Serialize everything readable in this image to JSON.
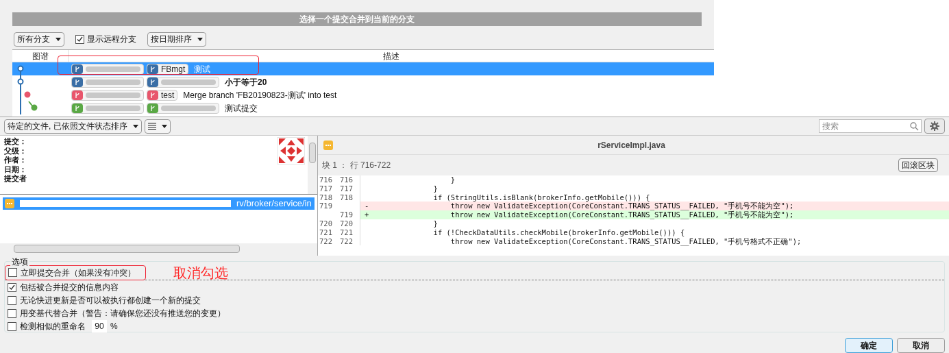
{
  "dialog": {
    "title": "选择一个提交合并到当前的分支",
    "toolbar": {
      "branch_filter": "所有分支",
      "show_remote": {
        "label": "显示远程分支",
        "checked": true
      },
      "sort": "按日期排序"
    },
    "columns": [
      "图谱",
      "描述"
    ],
    "commits": [
      {
        "selected": true,
        "refs": [
          {
            "color": "#3a6ea5"
          },
          {
            "label": "FBmgt",
            "color": "#3a6ea5"
          }
        ],
        "description": "测试",
        "bold": false,
        "color": "#2d6fb0"
      },
      {
        "selected": false,
        "refs": [
          {
            "color": "#3a6ea5"
          },
          {
            "color": "#3a6ea5"
          }
        ],
        "description": "小于等于20",
        "bold": true,
        "color": "#2d6fb0"
      },
      {
        "selected": false,
        "refs": [
          {
            "color": "#e8566c"
          },
          {
            "label": "test",
            "color": "#e8566c"
          }
        ],
        "description": "Merge branch 'FB20190823-测试' into test",
        "bold": false,
        "color": "#e8566c"
      },
      {
        "selected": false,
        "refs": [
          {
            "color": "#5aa845"
          },
          {
            "color": "#5aa845"
          }
        ],
        "description": "测试提交",
        "bold": false,
        "color": "#5aa845"
      }
    ],
    "annotation": "取消勾选"
  },
  "files_toolbar": {
    "sort": "待定的文件, 已依照文件状态排序",
    "search": {
      "placeholder": "搜索"
    }
  },
  "commit_info": [
    "提交：",
    "父级：",
    "作者：",
    "日期：",
    "提交者"
  ],
  "files": [
    {
      "path": "rv/broker/service/in",
      "selected": true
    }
  ],
  "diff": {
    "filename": "rServiceImpl.java",
    "hunk": "块 1 ： 行 716-722",
    "revert": "回滚区块",
    "lines": [
      {
        "old": "716",
        "new": "716",
        "kind": "context",
        "code": "            }"
      },
      {
        "old": "717",
        "new": "717",
        "kind": "context",
        "code": "        }"
      },
      {
        "old": "718",
        "new": "718",
        "kind": "context",
        "code": "        if (StringUtils.isBlank(brokerInfo.getMobile())) {"
      },
      {
        "old": "719",
        "sign": "-",
        "kind": "removed",
        "code": "            throw new ValidateException(CoreConstant.TRANS_STATUS__FAILED, \"手机号不能为空\");"
      },
      {
        "new": "719",
        "sign": "+",
        "kind": "added",
        "code": "            throw new ValidateException(CoreConstant.TRANS_STATUS__FAILED, \"手机号不能为空\");"
      },
      {
        "old": "720",
        "new": "720",
        "kind": "context",
        "code": "        }"
      },
      {
        "old": "721",
        "new": "721",
        "kind": "context",
        "code": "        if (!CheckDataUtils.checkMobile(brokerInfo.getMobile())) {"
      },
      {
        "old": "722",
        "new": "722",
        "kind": "context",
        "code": "            throw new ValidateException(CoreConstant.TRANS_STATUS__FAILED, \"手机号格式不正确\");"
      }
    ]
  },
  "options": {
    "title": "选项",
    "items": [
      {
        "label": "立即提交合并（如果没有冲突）",
        "checked": false
      },
      {
        "label": "包括被合并提交的信息内容",
        "checked": true
      },
      {
        "label": "无论快进更新是否可以被执行都创建一个新的提交",
        "checked": false
      },
      {
        "label": "用变基代替合并（警告：请确保您还没有推送您的变更）",
        "checked": false
      },
      {
        "label": "检测相似的重命名",
        "checked": false,
        "value": "90",
        "unit": "%"
      }
    ]
  },
  "buttons": [
    "确定",
    "取消"
  ]
}
